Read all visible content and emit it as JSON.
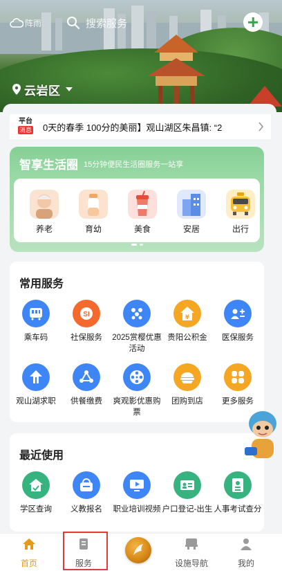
{
  "header": {
    "weather_text": "阵雨",
    "search_placeholder": "搜索服务",
    "location": "云岩区"
  },
  "news": {
    "badge_top": "平台",
    "badge_bottom": "消息",
    "text": "0天的春季  100分的美丽】观山湖区朱昌镇: “2"
  },
  "life_circle": {
    "title": "智享生活圈",
    "subtitle": "15分钟便民生活圈服务一站享",
    "items": [
      {
        "label": "养老",
        "icon": "elderly-icon"
      },
      {
        "label": "育幼",
        "icon": "baby-bottle-icon"
      },
      {
        "label": "美食",
        "icon": "drink-icon"
      },
      {
        "label": "安居",
        "icon": "building-icon"
      },
      {
        "label": "出行",
        "icon": "taxi-icon"
      }
    ]
  },
  "common_services": {
    "title": "常用服务",
    "items": [
      {
        "label": "乘车码",
        "icon": "bus-card-icon",
        "color": "#3e86f5"
      },
      {
        "label": "社保服务",
        "icon": "social-security-icon",
        "color": "#f36a2c"
      },
      {
        "label": "2025赏樱优惠活动",
        "icon": "cherry-blossom-icon",
        "color": "#3e86f5"
      },
      {
        "label": "贵阳公积金",
        "icon": "housing-fund-icon",
        "color": "#f5a623"
      },
      {
        "label": "医保服务",
        "icon": "medical-insurance-icon",
        "color": "#3e86f5"
      },
      {
        "label": "观山湖求职",
        "icon": "job-search-icon",
        "color": "#3e86f5"
      },
      {
        "label": "供餐缴费",
        "icon": "meal-payment-icon",
        "color": "#3e86f5"
      },
      {
        "label": "爽观影优惠购票",
        "icon": "film-reel-icon",
        "color": "#3e86f5"
      },
      {
        "label": "团购到店",
        "icon": "group-buy-icon",
        "color": "#f5a623"
      },
      {
        "label": "更多服务",
        "icon": "more-services-icon",
        "color": "#f5a623"
      }
    ]
  },
  "recent": {
    "title": "最近使用",
    "items": [
      {
        "label": "学区查询",
        "icon": "school-district-icon",
        "color": "#36b37e"
      },
      {
        "label": "义教报名",
        "icon": "enrollment-icon",
        "color": "#3e86f5"
      },
      {
        "label": "职业培训视频",
        "icon": "training-video-icon",
        "color": "#3e86f5"
      },
      {
        "label": "户口登记-出生",
        "icon": "household-register-icon",
        "color": "#36b37e"
      },
      {
        "label": "人事考试查分",
        "icon": "exam-score-icon",
        "color": "#36b37e"
      }
    ]
  },
  "tabbar": {
    "items": [
      {
        "label": "首页",
        "icon": "home-icon"
      },
      {
        "label": "服务",
        "icon": "service-icon"
      },
      {
        "label": "设施导航",
        "icon": "facility-nav-icon"
      },
      {
        "label": "我的",
        "icon": "profile-icon"
      }
    ],
    "active_color": "#e69a1a",
    "highlight_color": "#e23a3a"
  }
}
